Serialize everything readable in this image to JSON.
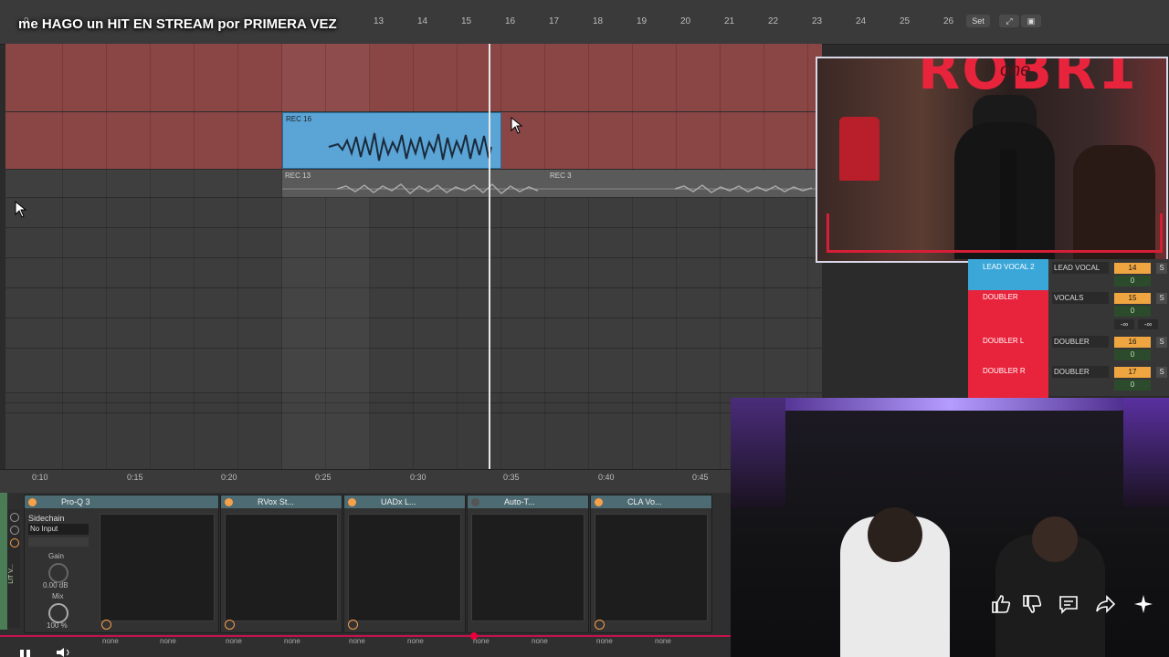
{
  "video": {
    "title": "me HAGO un HIT EN STREAM por PRIMERA VEZ"
  },
  "ruler": {
    "bars": [
      "9",
      "13",
      "14",
      "15",
      "16",
      "17",
      "18",
      "19",
      "20",
      "21",
      "22",
      "23",
      "24",
      "25",
      "26"
    ]
  },
  "toolbar": {
    "set_label": "Set"
  },
  "arrangement": {
    "clips": {
      "rec16": "REC 16",
      "rec13": "REC 13",
      "rec3": "REC 3"
    }
  },
  "time_ruler": {
    "labels": [
      "0:10",
      "0:15",
      "0:20",
      "0:25",
      "0:30",
      "0:35",
      "0:40",
      "0:45"
    ]
  },
  "devices": [
    {
      "name": "Pro-Q 3"
    },
    {
      "name": "RVox St..."
    },
    {
      "name": "UADx L..."
    },
    {
      "name": "Auto-T..."
    },
    {
      "name": "CLA Vo..."
    }
  ],
  "sidechain": {
    "label": "Sidechain",
    "input": "No Input",
    "gain_label": "Gain",
    "gain_value": "0.00 dB",
    "mix_label": "Mix",
    "mix_value": "100 %"
  },
  "left_strip_text": "LIT V...",
  "routing_none": "none",
  "mixer": {
    "tracks": [
      {
        "name": "LEAD VOCAL 2",
        "route": "LEAD VOCAL",
        "num": "14",
        "zero": "0",
        "s": "S",
        "color": "#3ba7d9"
      },
      {
        "name": "DOUBLER",
        "route": "VOCALS",
        "num": "15",
        "zero": "0",
        "s": "S",
        "color": "#e8233c"
      },
      {
        "name": "DOUBLER L",
        "route": "DOUBLER",
        "num": "16",
        "zero": "0",
        "s": "S",
        "color": "#e8233c"
      },
      {
        "name": "DOUBLER R",
        "route": "DOUBLER",
        "num": "17",
        "zero": "0",
        "s": "S",
        "color": "#e8233c"
      }
    ],
    "inf_left": "-∞",
    "inf_right": "-∞"
  },
  "webcam_top": {
    "brand": "ROBR1",
    "script": "one"
  },
  "icons": [
    "like-icon",
    "dislike-icon",
    "comments-icon",
    "share-icon",
    "sparkle-icon",
    "mouse-cursor-icon",
    "pause-icon",
    "volume-icon"
  ],
  "colors": {
    "track_red": "#8a4545",
    "clip_blue": "#5aa4d6",
    "accent_orange": "#f7a04a",
    "device_teal": "#4d6b73"
  }
}
